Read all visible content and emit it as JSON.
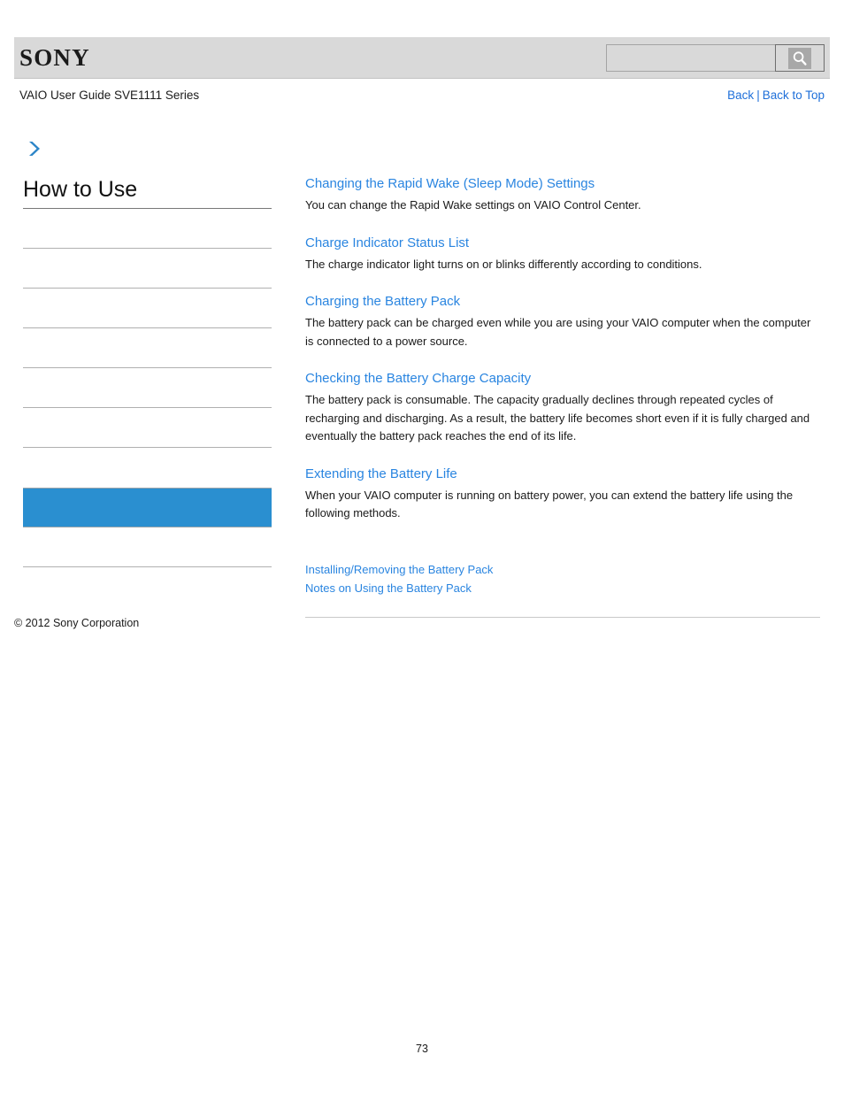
{
  "header": {
    "logo_text": "SONY",
    "search": {
      "value": "",
      "placeholder": "",
      "icon": "search-icon"
    }
  },
  "title_row": {
    "guide_title": "VAIO User Guide SVE1111 Series",
    "back_label": "Back",
    "separator": "|",
    "back_to_top_label": "Back to Top"
  },
  "sidebar": {
    "breadcrumb_icon": "chevron-right-icon",
    "heading": "How to Use",
    "items": [
      {
        "label": "",
        "active": false
      },
      {
        "label": "",
        "active": false
      },
      {
        "label": "",
        "active": false
      },
      {
        "label": "",
        "active": false
      },
      {
        "label": "",
        "active": false
      },
      {
        "label": "",
        "active": false
      },
      {
        "label": "",
        "active": false
      },
      {
        "label": "",
        "active": true
      },
      {
        "label": "",
        "active": false
      }
    ],
    "copyright": "© 2012 Sony Corporation"
  },
  "content": {
    "topics": [
      {
        "link": "Changing the Rapid Wake (Sleep Mode) Settings",
        "desc": "You can change the Rapid Wake settings on VAIO Control Center."
      },
      {
        "link": "Charge Indicator Status List",
        "desc": "The charge indicator light turns on or blinks differently according to conditions."
      },
      {
        "link": "Charging the Battery Pack",
        "desc": "The battery pack can be charged even while you are using your VAIO computer when the computer is connected to a power source."
      },
      {
        "link": "Checking the Battery Charge Capacity",
        "desc": "The battery pack is consumable. The capacity gradually declines through repeated cycles of recharging and discharging. As a result, the battery life becomes short even if it is fully charged and eventually the battery pack reaches the end of its life."
      },
      {
        "link": "Extending the Battery Life",
        "desc": "When your VAIO computer is running on battery power, you can extend the battery life using the following methods."
      }
    ],
    "related_links": [
      "Installing/Removing the Battery Pack",
      "Notes on Using the Battery Pack"
    ]
  },
  "footer": {
    "page_number": "73"
  },
  "colors": {
    "link_blue": "#2a85e0",
    "nav_blue": "#1e6fd9",
    "active_item_blue": "#2a8fd0",
    "header_gray": "#d9d9d9"
  }
}
